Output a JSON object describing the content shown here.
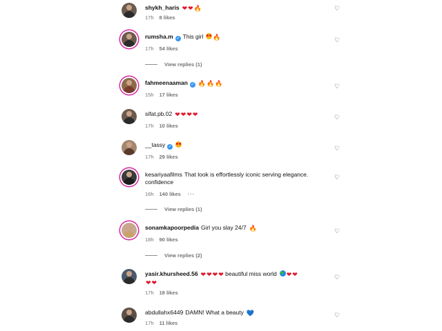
{
  "comments": [
    {
      "username": "shykh_haris",
      "verified": false,
      "text": "",
      "emoji": [
        "heart",
        "heart",
        "flame"
      ],
      "time": "17h",
      "likes": "8 likes",
      "more": false
    },
    {
      "username": "rumsha.m",
      "verified": true,
      "text": "This girl",
      "emoji": [
        "face",
        "flame"
      ],
      "time": "17h",
      "likes": "54 likes",
      "more": false
    },
    {
      "username": "fahmeenaaman",
      "verified": true,
      "text": "",
      "emoji": [
        "flame",
        "flame",
        "flame"
      ],
      "time": "15h",
      "likes": "17 likes",
      "more": false
    },
    {
      "username": "sifat.pb.02",
      "verified": false,
      "text": "",
      "emoji": [
        "heart",
        "heart",
        "heart",
        "heart"
      ],
      "time": "17h",
      "likes": "10 likes",
      "more": false
    },
    {
      "username": "__tassy",
      "verified": true,
      "text": "",
      "emoji": [
        "face"
      ],
      "time": "17h",
      "likes": "29 likes",
      "more": false
    },
    {
      "username": "kesariyaafilms",
      "verified": false,
      "text": "That look is effortlessly iconic serving elegance. confidence",
      "emoji": [],
      "time": "16h",
      "likes": "140 likes",
      "more": true
    },
    {
      "username": "sonamkapoorpedia",
      "verified": false,
      "text": "Girl you slay 24/7",
      "emoji": [
        "flame"
      ],
      "time": "18h",
      "likes": "90 likes",
      "more": false
    },
    {
      "username": "yasir.khursheed.56",
      "verified": false,
      "text": "beautiful miss world",
      "emoji": [
        "heart",
        "heart",
        "heart",
        "heart"
      ],
      "emoji_after": [
        "globe",
        "heart",
        "heart",
        "heart",
        "heart"
      ],
      "time": "17h",
      "likes": "18 likes",
      "more": false
    },
    {
      "username": "abdullahx6449",
      "verified": false,
      "text": "DAMN! What a beauty",
      "emoji": [
        "blueheart"
      ],
      "time": "17h",
      "likes": "11 likes",
      "more": false
    }
  ],
  "view_replies": [
    "View replies (1)",
    "View replies (1)",
    "View replies (2)"
  ],
  "more_label": "···",
  "verified_mark": "✓",
  "icons": {
    "like": "heart-outline-icon",
    "verified": "verified-badge-icon"
  }
}
